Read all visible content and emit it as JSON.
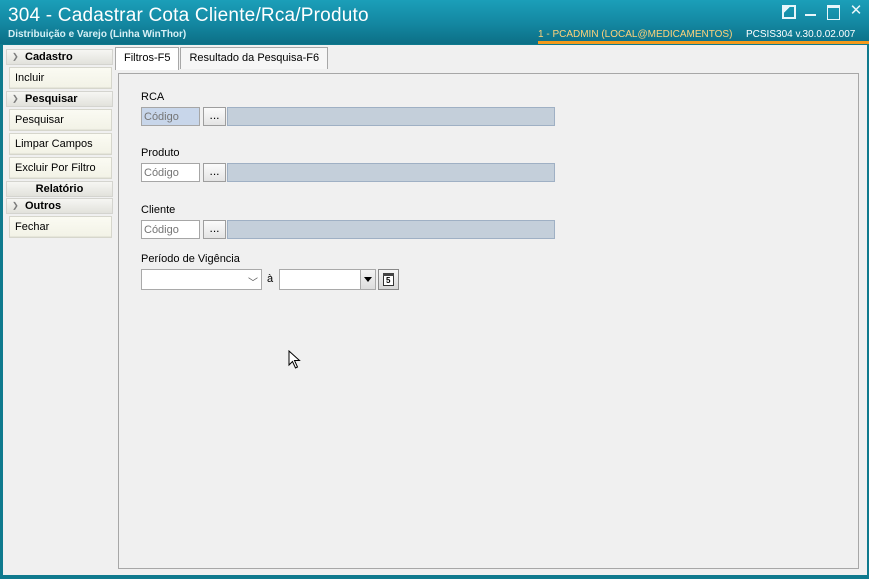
{
  "window": {
    "title": "304 - Cadastrar Cota Cliente/Rca/Produto",
    "subtitle": "Distribuição e Varejo (Linha WinThor)",
    "user": "1 - PCADMIN (LOCAL@MEDICAMENTOS)",
    "version": "PCSIS304  v.30.0.02.007",
    "close_glyph": "✕"
  },
  "sidebar": {
    "cadastro": {
      "title": "Cadastro",
      "items": [
        "Incluir"
      ]
    },
    "pesquisar": {
      "title": "Pesquisar",
      "items": [
        "Pesquisar",
        "Limpar Campos",
        "Excluir Por Filtro"
      ]
    },
    "relatorio": {
      "title": "Relatório"
    },
    "outros": {
      "title": "Outros",
      "items": [
        "Fechar"
      ]
    }
  },
  "tabs": [
    "Filtros-F5",
    "Resultado da Pesquisa-F6"
  ],
  "filters": {
    "rca": {
      "label": "RCA",
      "placeholder": "Código",
      "button": "..."
    },
    "produto": {
      "label": "Produto",
      "placeholder": "Código",
      "button": "..."
    },
    "cliente": {
      "label": "Cliente",
      "placeholder": "Código",
      "button": "..."
    },
    "periodo": {
      "label": "Período de Vigência",
      "separator": "à",
      "start": "",
      "end": "",
      "calendar_icon": "calendar-icon"
    }
  },
  "colors": {
    "titlebar": "#1489a3",
    "accent_line": "#f39a1c",
    "readonly_field": "#c4cfda"
  }
}
